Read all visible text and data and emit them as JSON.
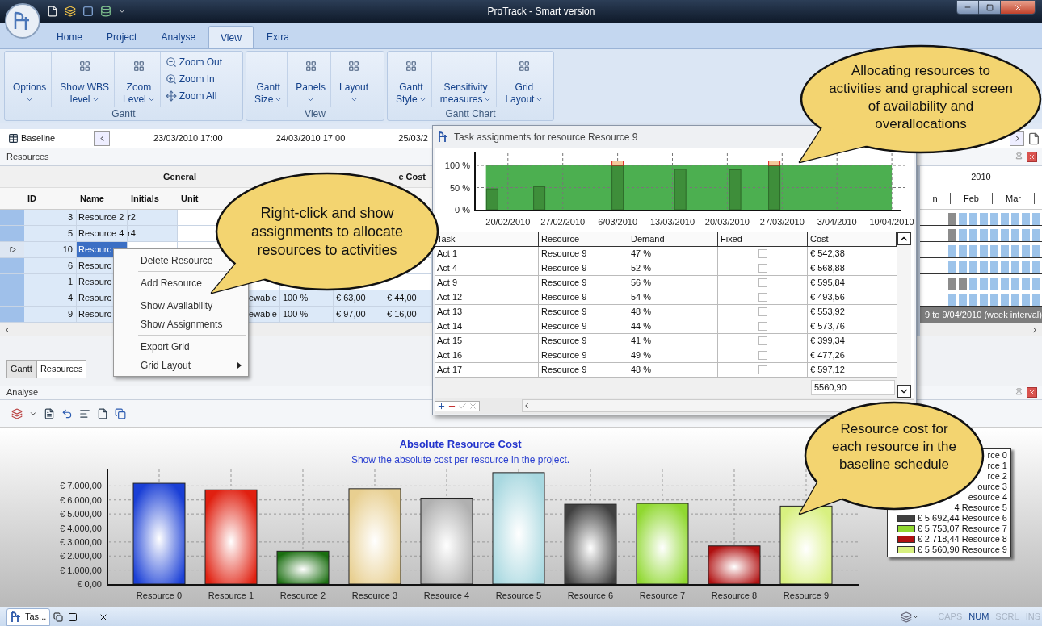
{
  "window": {
    "title": "ProTrack - Smart version"
  },
  "ribbon": {
    "tabs": [
      {
        "label": "Home",
        "selected": false
      },
      {
        "label": "Project",
        "selected": false
      },
      {
        "label": "Analyse",
        "selected": false
      },
      {
        "label": "View",
        "selected": true
      },
      {
        "label": "Extra",
        "selected": false
      }
    ],
    "groups": [
      {
        "label": "Gantt",
        "items": [
          {
            "kind": "text",
            "lines": [
              "Options"
            ],
            "dropdown": true
          },
          {
            "kind": "icon",
            "lines": [
              "Show WBS",
              "level"
            ],
            "dropdown": true
          },
          {
            "kind": "icon",
            "lines": [
              "Zoom",
              "Level"
            ],
            "dropdown": true
          },
          {
            "kind": "stack",
            "buttons": [
              "Zoom Out",
              "Zoom In",
              "Zoom All"
            ]
          }
        ]
      },
      {
        "label": "View",
        "items": [
          {
            "kind": "text",
            "lines": [
              "Gantt",
              "Size"
            ],
            "dropdown": true
          },
          {
            "kind": "icon",
            "lines": [
              "Panels"
            ],
            "dropdown": true
          },
          {
            "kind": "icon",
            "lines": [
              "Layout"
            ],
            "dropdown": true
          }
        ]
      },
      {
        "label": "Gantt Chart",
        "items": [
          {
            "kind": "icon",
            "lines": [
              "Gantt",
              "Style"
            ],
            "dropdown": true
          },
          {
            "kind": "text",
            "lines": [
              "Sensitivity",
              "measures"
            ],
            "dropdown": true
          },
          {
            "kind": "icon",
            "lines": [
              "Grid",
              "Layout"
            ],
            "dropdown": true
          }
        ]
      }
    ]
  },
  "baseline_bar": {
    "label": "Baseline",
    "dates": [
      "23/03/2010 17:00",
      "24/03/2010 17:00",
      "25/03/2"
    ]
  },
  "resources": {
    "title": "Resources",
    "group_headers": [
      "General",
      "e Cost"
    ],
    "columns": [
      "ID",
      "Name",
      "Initials",
      "Unit"
    ],
    "rows": [
      {
        "id": "3",
        "name": "Resource 2",
        "initials": "r2",
        "selected": false
      },
      {
        "id": "5",
        "name": "Resource 4",
        "initials": "r4",
        "selected": false
      },
      {
        "id": "10",
        "name": "Resourc",
        "selected": true
      },
      {
        "id": "6",
        "name": "Resourc",
        "selected": false
      },
      {
        "id": "1",
        "name": "Resourc",
        "selected": false
      },
      {
        "id": "4",
        "name": "Resourc",
        "selected": false,
        "extra": [
          "ewable",
          "100 %",
          "€ 63,00",
          "€ 44,00"
        ]
      },
      {
        "id": "9",
        "name": "Resourc",
        "selected": false,
        "extra": [
          "ewable",
          "100 %",
          "€ 97,00",
          "€ 16,00"
        ]
      }
    ]
  },
  "gantt": {
    "year": "2010",
    "months": [
      "n",
      "Feb",
      "Mar"
    ],
    "interval_note": "9 to 9/04/2010 (week interval)"
  },
  "context_menu": {
    "items": [
      {
        "label": "Delete Resource",
        "submenu": false,
        "separator_after": true
      },
      {
        "label": "Add Resource",
        "submenu": false,
        "separator_after": true
      },
      {
        "label": "Show Availability",
        "submenu": false,
        "separator_after": false
      },
      {
        "label": "Show Assignments",
        "submenu": false,
        "separator_after": true
      },
      {
        "label": "Export Grid",
        "submenu": false,
        "separator_after": false
      },
      {
        "label": "Grid Layout",
        "submenu": true,
        "separator_after": false
      }
    ]
  },
  "bottom_tabs": [
    {
      "label": "Gantt",
      "selected": false
    },
    {
      "label": "Resources",
      "selected": true
    }
  ],
  "analyse": {
    "title": "Analyse",
    "chart": {
      "title": "Absolute Resource Cost",
      "subtitle": "Show the absolute cost per resource in the project.",
      "chart_data": {
        "type": "bar",
        "grid": true,
        "categories": [
          "Resource 0",
          "Resource 1",
          "Resource 2",
          "Resource 3",
          "Resource 4",
          "Resource 5",
          "Resource 6",
          "Resource 7",
          "Resource 8",
          "Resource 9"
        ],
        "series": [
          {
            "values": [
              7190,
              6720,
              2340,
              6800,
              6130,
              7950,
              5692,
              5753,
              2718,
              5561
            ]
          }
        ],
        "ylim": [
          0,
          8000
        ],
        "yticks": [
          {
            "value": 0,
            "label": "€ 0,00"
          },
          {
            "value": 1000,
            "label": "€ 1.000,00"
          },
          {
            "value": 2000,
            "label": "€ 2.000,00"
          },
          {
            "value": 3000,
            "label": "€ 3.000,00"
          },
          {
            "value": 4000,
            "label": "€ 4.000,00"
          },
          {
            "value": 5000,
            "label": "€ 5.000,00"
          },
          {
            "value": 6000,
            "label": "€ 6.000,00"
          },
          {
            "value": 7000,
            "label": "€ 7.000,00"
          }
        ]
      },
      "legend": [
        {
          "text": "rce 0"
        },
        {
          "text": "rce 1"
        },
        {
          "text": "rce 2"
        },
        {
          "text": "ource 3"
        },
        {
          "text": "esource 4"
        },
        {
          "text": "4 Resource 5"
        },
        {
          "text": "€ 5.692,44 Resource 6",
          "color": "#404040"
        },
        {
          "text": "€ 5.753,07 Resource 7",
          "color": "#90d830"
        },
        {
          "text": "€ 2.718,44 Resource 8",
          "color": "#b01010"
        },
        {
          "text": "€ 5.560,90 Resource 9",
          "color": "#d8f080"
        }
      ]
    }
  },
  "popup": {
    "title": "Task assignments for resource Resource 9",
    "chart_data": {
      "type": "bar",
      "grid": true,
      "stacked": true,
      "categories": [
        null,
        null,
        null,
        null,
        "20/02/2010",
        null,
        null,
        null,
        null,
        null,
        null,
        "27/02/2010",
        null,
        null,
        null,
        null,
        null,
        null,
        "6/03/2010",
        null,
        null,
        null,
        null,
        null,
        null,
        "13/03/2010",
        null,
        null,
        null,
        null,
        null,
        null,
        "20/03/2010",
        null,
        null,
        null,
        null,
        null,
        null,
        "27/03/2010",
        null,
        null,
        null,
        null,
        null,
        null,
        "3/04/2010",
        null,
        null,
        null,
        null,
        null,
        null,
        "10/04/2010",
        null
      ],
      "series": [
        {
          "color": "#3e8e3a",
          "values": [
            null,
            null,
            47,
            null,
            null,
            null,
            null,
            null,
            52,
            null,
            null,
            null,
            null,
            null,
            null,
            null,
            null,
            null,
            100,
            null,
            null,
            null,
            null,
            null,
            null,
            null,
            91,
            null,
            null,
            null,
            null,
            null,
            null,
            90,
            null,
            null,
            null,
            null,
            100,
            null,
            null,
            null,
            null,
            null,
            null,
            null,
            null,
            null,
            null,
            null,
            null,
            null,
            null,
            null,
            null
          ]
        },
        {
          "color": "#f5c89a",
          "values": [
            null,
            null,
            null,
            null,
            null,
            null,
            null,
            null,
            null,
            null,
            null,
            null,
            null,
            null,
            null,
            null,
            null,
            null,
            10,
            null,
            null,
            null,
            null,
            null,
            null,
            null,
            null,
            null,
            null,
            null,
            null,
            null,
            null,
            null,
            null,
            null,
            null,
            null,
            10,
            null,
            null,
            null,
            null,
            null,
            null,
            null,
            null,
            null,
            null,
            null,
            null,
            null,
            null,
            null,
            null
          ]
        }
      ],
      "ylim": [
        0,
        110
      ],
      "yticks": [
        {
          "value": 0,
          "label": "0 %"
        },
        {
          "value": 50,
          "label": "50 %"
        },
        {
          "value": 100,
          "label": "100 %"
        }
      ]
    },
    "columns": [
      "Task",
      "Resource",
      "Demand",
      "Fixed",
      "Cost"
    ],
    "rows": [
      {
        "task": "Act 1",
        "resource": "Resource 9",
        "demand": "47 %",
        "fixed": false,
        "cost": "€ 542,38"
      },
      {
        "task": "Act 4",
        "resource": "Resource 9",
        "demand": "52 %",
        "fixed": false,
        "cost": "€ 568,88"
      },
      {
        "task": "Act 9",
        "resource": "Resource 9",
        "demand": "56 %",
        "fixed": false,
        "cost": "€ 595,84"
      },
      {
        "task": "Act 12",
        "resource": "Resource 9",
        "demand": "54 %",
        "fixed": false,
        "cost": "€ 493,56"
      },
      {
        "task": "Act 13",
        "resource": "Resource 9",
        "demand": "48 %",
        "fixed": false,
        "cost": "€ 553,92"
      },
      {
        "task": "Act 14",
        "resource": "Resource 9",
        "demand": "44 %",
        "fixed": false,
        "cost": "€ 573,76"
      },
      {
        "task": "Act 15",
        "resource": "Resource 9",
        "demand": "41 %",
        "fixed": false,
        "cost": "€ 399,34"
      },
      {
        "task": "Act 16",
        "resource": "Resource 9",
        "demand": "49 %",
        "fixed": false,
        "cost": "€ 477,26"
      },
      {
        "task": "Act 17",
        "resource": "Resource 9",
        "demand": "48 %",
        "fixed": false,
        "cost": "€ 597,12"
      }
    ],
    "total": "5560,90"
  },
  "callouts": [
    {
      "text": "Right-click and show assignments to allocate resources to activities"
    },
    {
      "text": "Allocating resources to activities and graphical screen of availability and overallocations"
    },
    {
      "text": "Resource cost for each resource in the baseline schedule"
    }
  ],
  "status_bar": {
    "task_label": "Tas...",
    "indicators": [
      {
        "label": "CAPS",
        "on": false
      },
      {
        "label": "NUM",
        "on": true
      },
      {
        "label": "SCRL",
        "on": false
      },
      {
        "label": "INS",
        "on": false
      }
    ]
  }
}
